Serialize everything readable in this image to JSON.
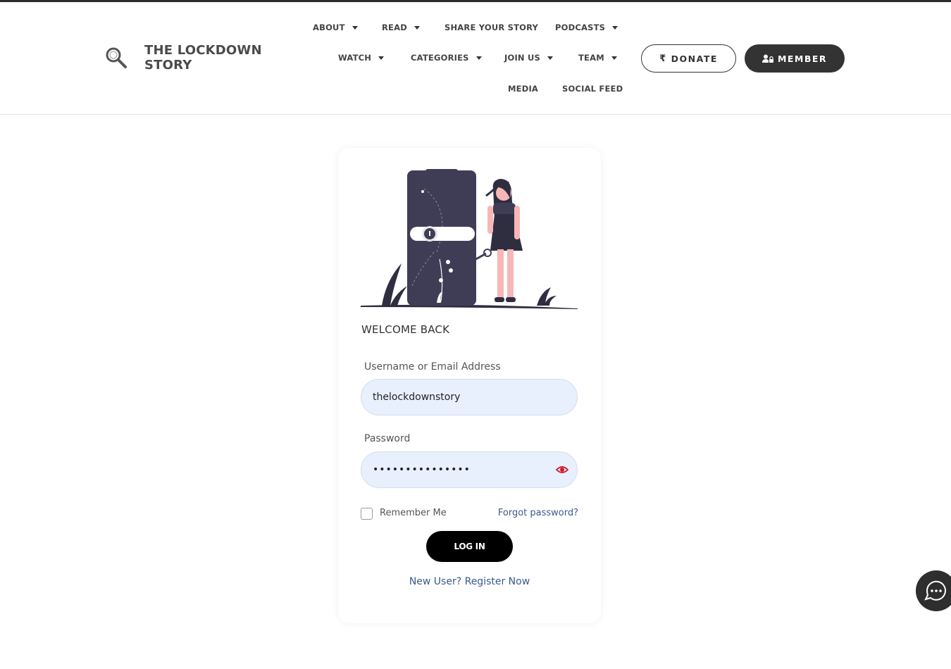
{
  "header": {
    "logo_text": "THE LOCKDOWN STORY",
    "nav": {
      "about": "ABOUT",
      "read": "READ",
      "share": "SHARE YOUR STORY",
      "podcasts": "PODCASTS",
      "watch": "WATCH",
      "categories": "CATEGORIES",
      "join": "JOIN US",
      "team": "TEAM",
      "media": "MEDIA",
      "social": "SOCIAL FEED"
    },
    "donate_label": "DONATE",
    "donate_icon": "₹",
    "member_label": "MEMBER"
  },
  "login": {
    "welcome": "WELCOME BACK",
    "username_label": "Username or Email Address",
    "username_value": "thelockdownstory",
    "password_label": "Password",
    "password_value": "•••••••••••••••",
    "remember_label": "Remember Me",
    "forgot_label": "Forgot password?",
    "login_label": "LOG IN",
    "register_label": "New User? Register Now"
  },
  "colors": {
    "dark": "#333333",
    "link": "#3a5a8c",
    "field_bg": "#e8f0fe",
    "eye": "#d11a2a"
  }
}
